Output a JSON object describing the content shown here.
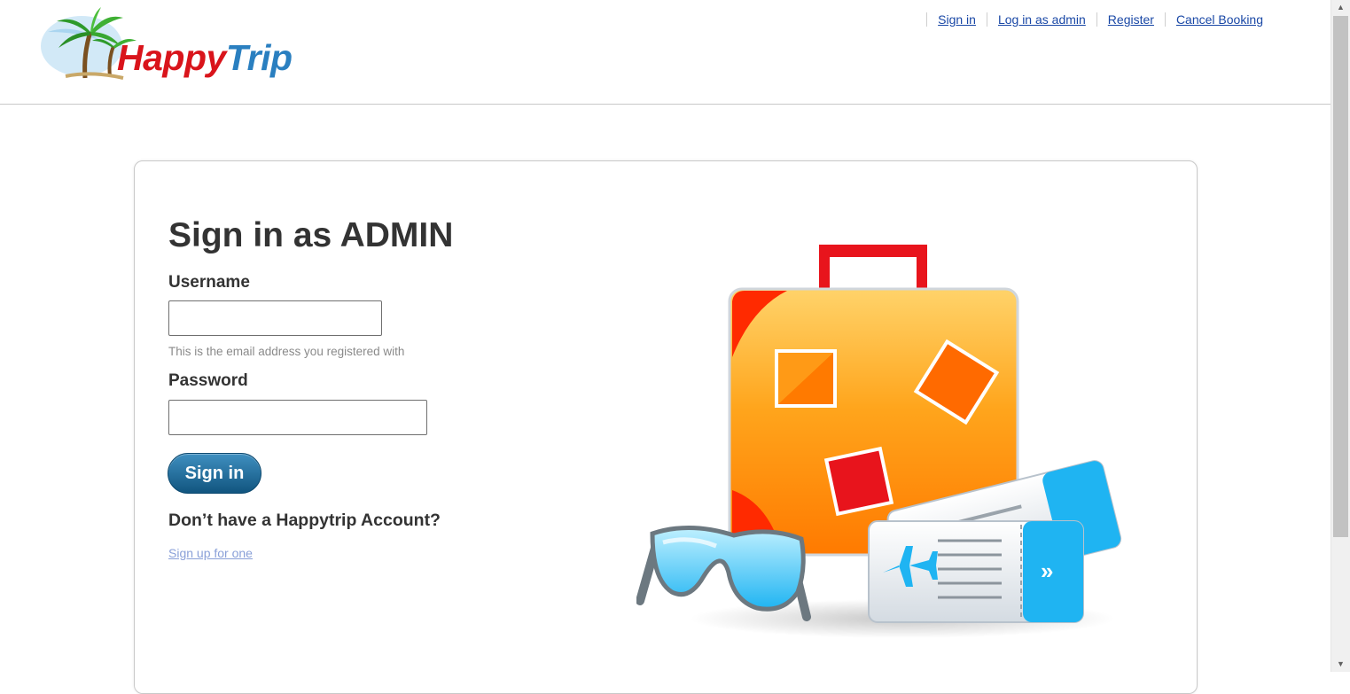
{
  "brand": {
    "part1": "Happy",
    "part2": "Trip"
  },
  "topnav": [
    {
      "label": "Sign in"
    },
    {
      "label": "Log in as admin"
    },
    {
      "label": "Register"
    },
    {
      "label": "Cancel Booking"
    }
  ],
  "form": {
    "title": "Sign in as ADMIN",
    "username_label": "Username",
    "username_value": "",
    "username_hint": "This is the email address you registered with",
    "password_label": "Password",
    "password_value": "",
    "submit_label": "Sign in",
    "no_account_text": "Don’t have a Happytrip Account?",
    "signup_link": "Sign up for one"
  },
  "colors": {
    "link": "#1a48a6",
    "button": "#1d6a99",
    "logo_red": "#d9141b",
    "logo_blue": "#2a7fc0"
  },
  "scrollbar": {
    "up_icon": "▲",
    "down_icon": "▼"
  }
}
